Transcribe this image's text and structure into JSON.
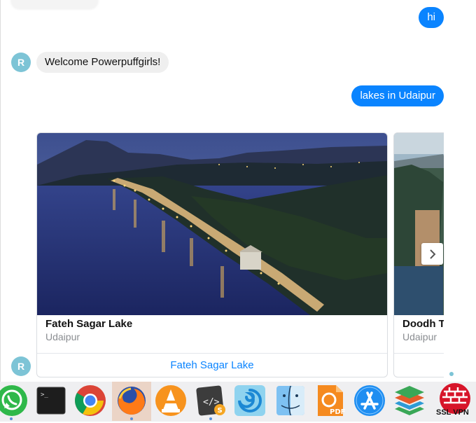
{
  "chat": {
    "messages": [
      {
        "from": "user",
        "text": "hi"
      },
      {
        "from": "bot",
        "avatar": "R",
        "text": "Welcome Powerpuffgirls!"
      },
      {
        "from": "user",
        "text": "lakes in Udaipur"
      }
    ],
    "carousel": {
      "avatar": "R",
      "cards": [
        {
          "title": "Fateh Sagar Lake",
          "subtitle": "Udaipur",
          "button": "Fateh Sagar Lake",
          "image": "night-lake-photo"
        },
        {
          "title": "Doodh T",
          "subtitle": "Udaipur",
          "button": "",
          "image": "lake-photo"
        }
      ],
      "next_icon": "chevron-right-icon"
    },
    "colors": {
      "user_bubble": "#0a84ff",
      "bot_bubble": "#efefef",
      "avatar": "#7dc4d6",
      "link": "#0a84ff"
    }
  },
  "dock": {
    "items": [
      {
        "name": "whatsapp-icon",
        "running": true
      },
      {
        "name": "terminal-icon",
        "running": false
      },
      {
        "name": "chrome-icon",
        "running": false
      },
      {
        "name": "firefox-icon",
        "running": true
      },
      {
        "name": "vlc-icon",
        "running": false
      },
      {
        "name": "sublime-text-icon",
        "running": true
      },
      {
        "name": "screenshot-tool-icon",
        "running": false
      },
      {
        "name": "finder-icon",
        "running": false
      },
      {
        "name": "pdf-reader-icon",
        "running": false
      },
      {
        "name": "app-store-icon",
        "running": false
      },
      {
        "name": "layers-app-icon",
        "running": false
      },
      {
        "name": "ssl-vpn-icon",
        "label": "SSL VPN",
        "running": true
      }
    ],
    "pdf_badge": "PDF",
    "ssl_vpn_label": "SSL VPN"
  }
}
